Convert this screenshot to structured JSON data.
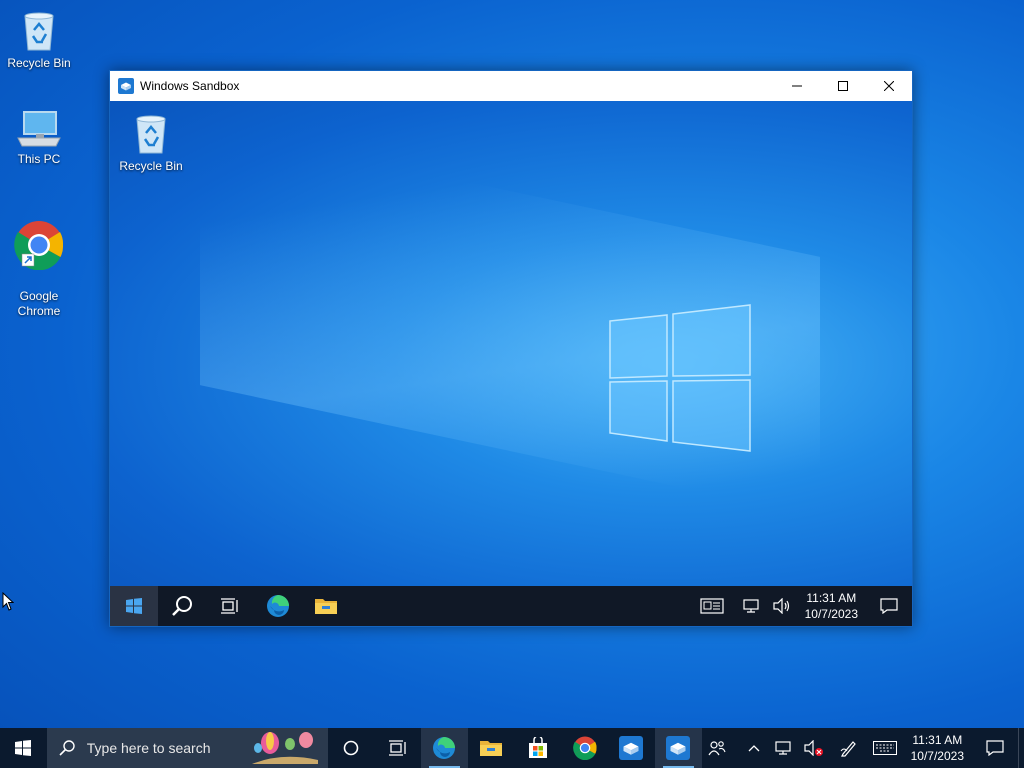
{
  "desktop": {
    "icons": [
      {
        "label": "Recycle Bin",
        "icon": "recycle-bin-icon"
      },
      {
        "label": "This PC",
        "icon": "this-pc-icon"
      },
      {
        "label": "Google\nChrome",
        "icon": "chrome-icon"
      }
    ]
  },
  "sandbox_window": {
    "title": "Windows Sandbox",
    "guest_desktop_icon": "Recycle Bin",
    "guest_taskbar": {
      "time": "11:31 AM",
      "date": "10/7/2023"
    }
  },
  "taskbar": {
    "search_placeholder": "Type here to search",
    "time": "11:31 AM",
    "date": "10/7/2023"
  },
  "colors": {
    "accent": "#0078d7",
    "taskbar_bg": "#0b1a2e"
  }
}
